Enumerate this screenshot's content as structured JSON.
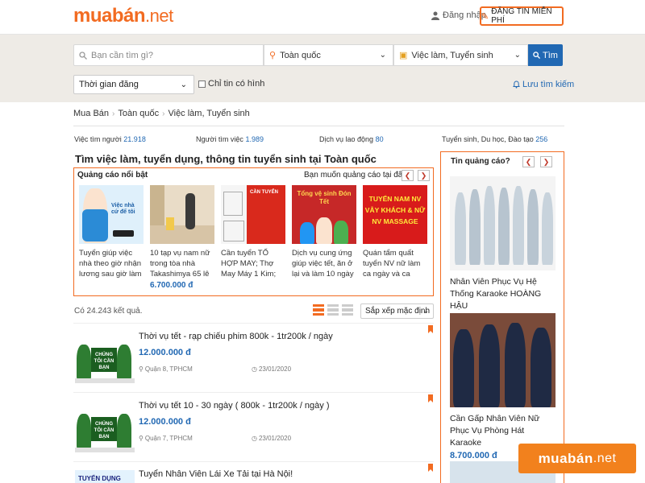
{
  "header": {
    "logo_main": "muabán",
    "logo_tld": ".net",
    "login": "Đăng nhập",
    "post_button": "ĐĂNG TIN MIỄN PHÍ"
  },
  "search": {
    "placeholder": "Bạn cần tìm gì?",
    "location": "Toàn quốc",
    "category": "Việc làm, Tuyển sinh",
    "submit": "Tìm",
    "time_filter": "Thời gian đăng",
    "only_images": "Chỉ tin có hình",
    "save_search": "Lưu tìm kiếm"
  },
  "breadcrumb": [
    "Mua Bán",
    "Toàn quốc",
    "Việc làm, Tuyển sinh"
  ],
  "stats": [
    {
      "label": "Việc tìm người",
      "count": "21.918"
    },
    {
      "label": "Người tìm việc",
      "count": "1.989"
    },
    {
      "label": "Dịch vụ lao động",
      "count": "80"
    },
    {
      "label": "Tuyển sinh, Du học, Đào tạo",
      "count": "256"
    }
  ],
  "page_title": "Tìm việc làm, tuyển dụng, thông tin tuyển sinh tại Toàn quốc",
  "featured_ads": {
    "heading": "Quảng cáo nổi bật",
    "ask": "Bạn muốn quảng cáo tại đây?",
    "items": [
      {
        "text": "Tuyển giúp việc nhà theo giờ nhận lương sau giờ làm nhận",
        "price": "",
        "img_text": "Việc nhà cứ để tôi"
      },
      {
        "text": "10 tạp vụ nam nữ trong tòa nhà Takashimya 65 lê lợi",
        "price": "6.700.000 đ",
        "img_text": ""
      },
      {
        "text": "Cần tuyển TỔ HỢP MAY; Thợ May Máy 1 Kim; Thợ THIẾT KẾ",
        "price": "",
        "img_text": "CẦN TUYỂN"
      },
      {
        "text": "Dịch vụ cung ứng giúp việc tết, ăn ở lại và làm 10 ngày tết-",
        "price": "",
        "img_text": "Tổng vệ sinh Đón Tết"
      },
      {
        "text": "Quán tẩm quất tuyển NV nữ làm ca ngày và ca đêm,",
        "price": "",
        "img_text": "TUYỂN NAM NV VẪY KHÁCH & NỮ NV MASSAGE"
      }
    ]
  },
  "results": {
    "count_text": "Có 24.243 kết quả.",
    "sort": "Sắp xếp mặc định"
  },
  "listings": [
    {
      "title": "Thời vụ tết - rạp chiếu phim 800k - 1tr200k / ngày",
      "price": "12.000.000 đ",
      "location": "Quận 8, TPHCM",
      "date": "23/01/2020",
      "thumb_text": "CHÚNG TÔI CẦN BẠN"
    },
    {
      "title": "Thời vụ tết 10 - 30 ngày ( 800k - 1tr200k / ngày )",
      "price": "12.000.000 đ",
      "location": "Quận 7, TPHCM",
      "date": "23/01/2020",
      "thumb_text": "CHÚNG TÔI CẦN BẠN"
    },
    {
      "title": "Tuyển Nhân Viên Lái Xe Tải tại Hà Nội!",
      "price": "",
      "location": "",
      "date": "",
      "thumb_text": "TUYỂN DỤNG"
    }
  ],
  "sidebar": {
    "heading": "Tin quảng cáo?",
    "items": [
      {
        "title": "Nhân Viên Phục Vụ Hệ Thống Karaoke HOÀNG HẬU",
        "price": ""
      },
      {
        "title": "Cần Gấp Nhân Viên Nữ Phục Vụ Phòng Hát Karaoke",
        "price": "8.700.000 đ"
      }
    ]
  },
  "watermark": {
    "main": "muabán",
    "tld": ".net"
  },
  "colors": {
    "brand": "#f26b21",
    "link": "#2168b3",
    "band": "#eeebe6"
  }
}
